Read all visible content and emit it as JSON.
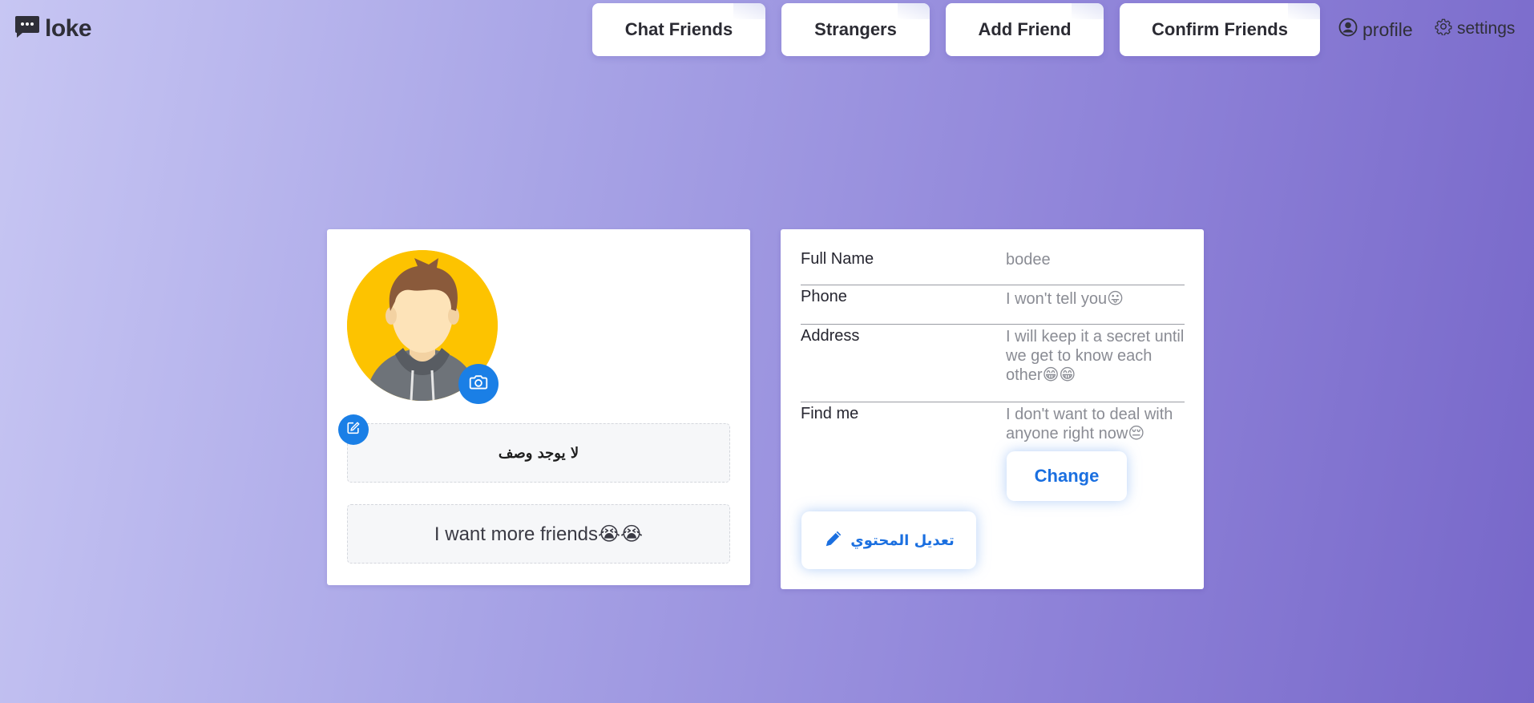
{
  "app": {
    "name": "loke"
  },
  "nav": {
    "chat_friends": "Chat Friends",
    "strangers": "Strangers",
    "add_friend": "Add Friend",
    "confirm_friends": "Confirm Friends",
    "profile": "profile",
    "settings": "settings"
  },
  "profile_card": {
    "description": "لا يوجد وصف",
    "status": "I want more friends😭😭"
  },
  "info": {
    "rows": [
      {
        "label": "Full Name",
        "value": "bodee"
      },
      {
        "label": "Phone",
        "value": "I won't tell you😛"
      },
      {
        "label": "Address",
        "value": "I will keep it a secret until we get to know each other😁😁"
      },
      {
        "label": "Find me",
        "value": "I don't want to deal with anyone right now😔"
      }
    ],
    "change_label": "Change",
    "edit_content_label": "تعديل المحتوي"
  },
  "colors": {
    "accent": "#1a7fe6",
    "avatar_bg": "#fdc300"
  },
  "icons": {
    "logo": "chat-bubble-icon",
    "profile": "user-circle-icon",
    "settings": "gear-icon",
    "camera": "camera-icon",
    "edit": "edit-icon",
    "pencil": "pencil-icon"
  }
}
